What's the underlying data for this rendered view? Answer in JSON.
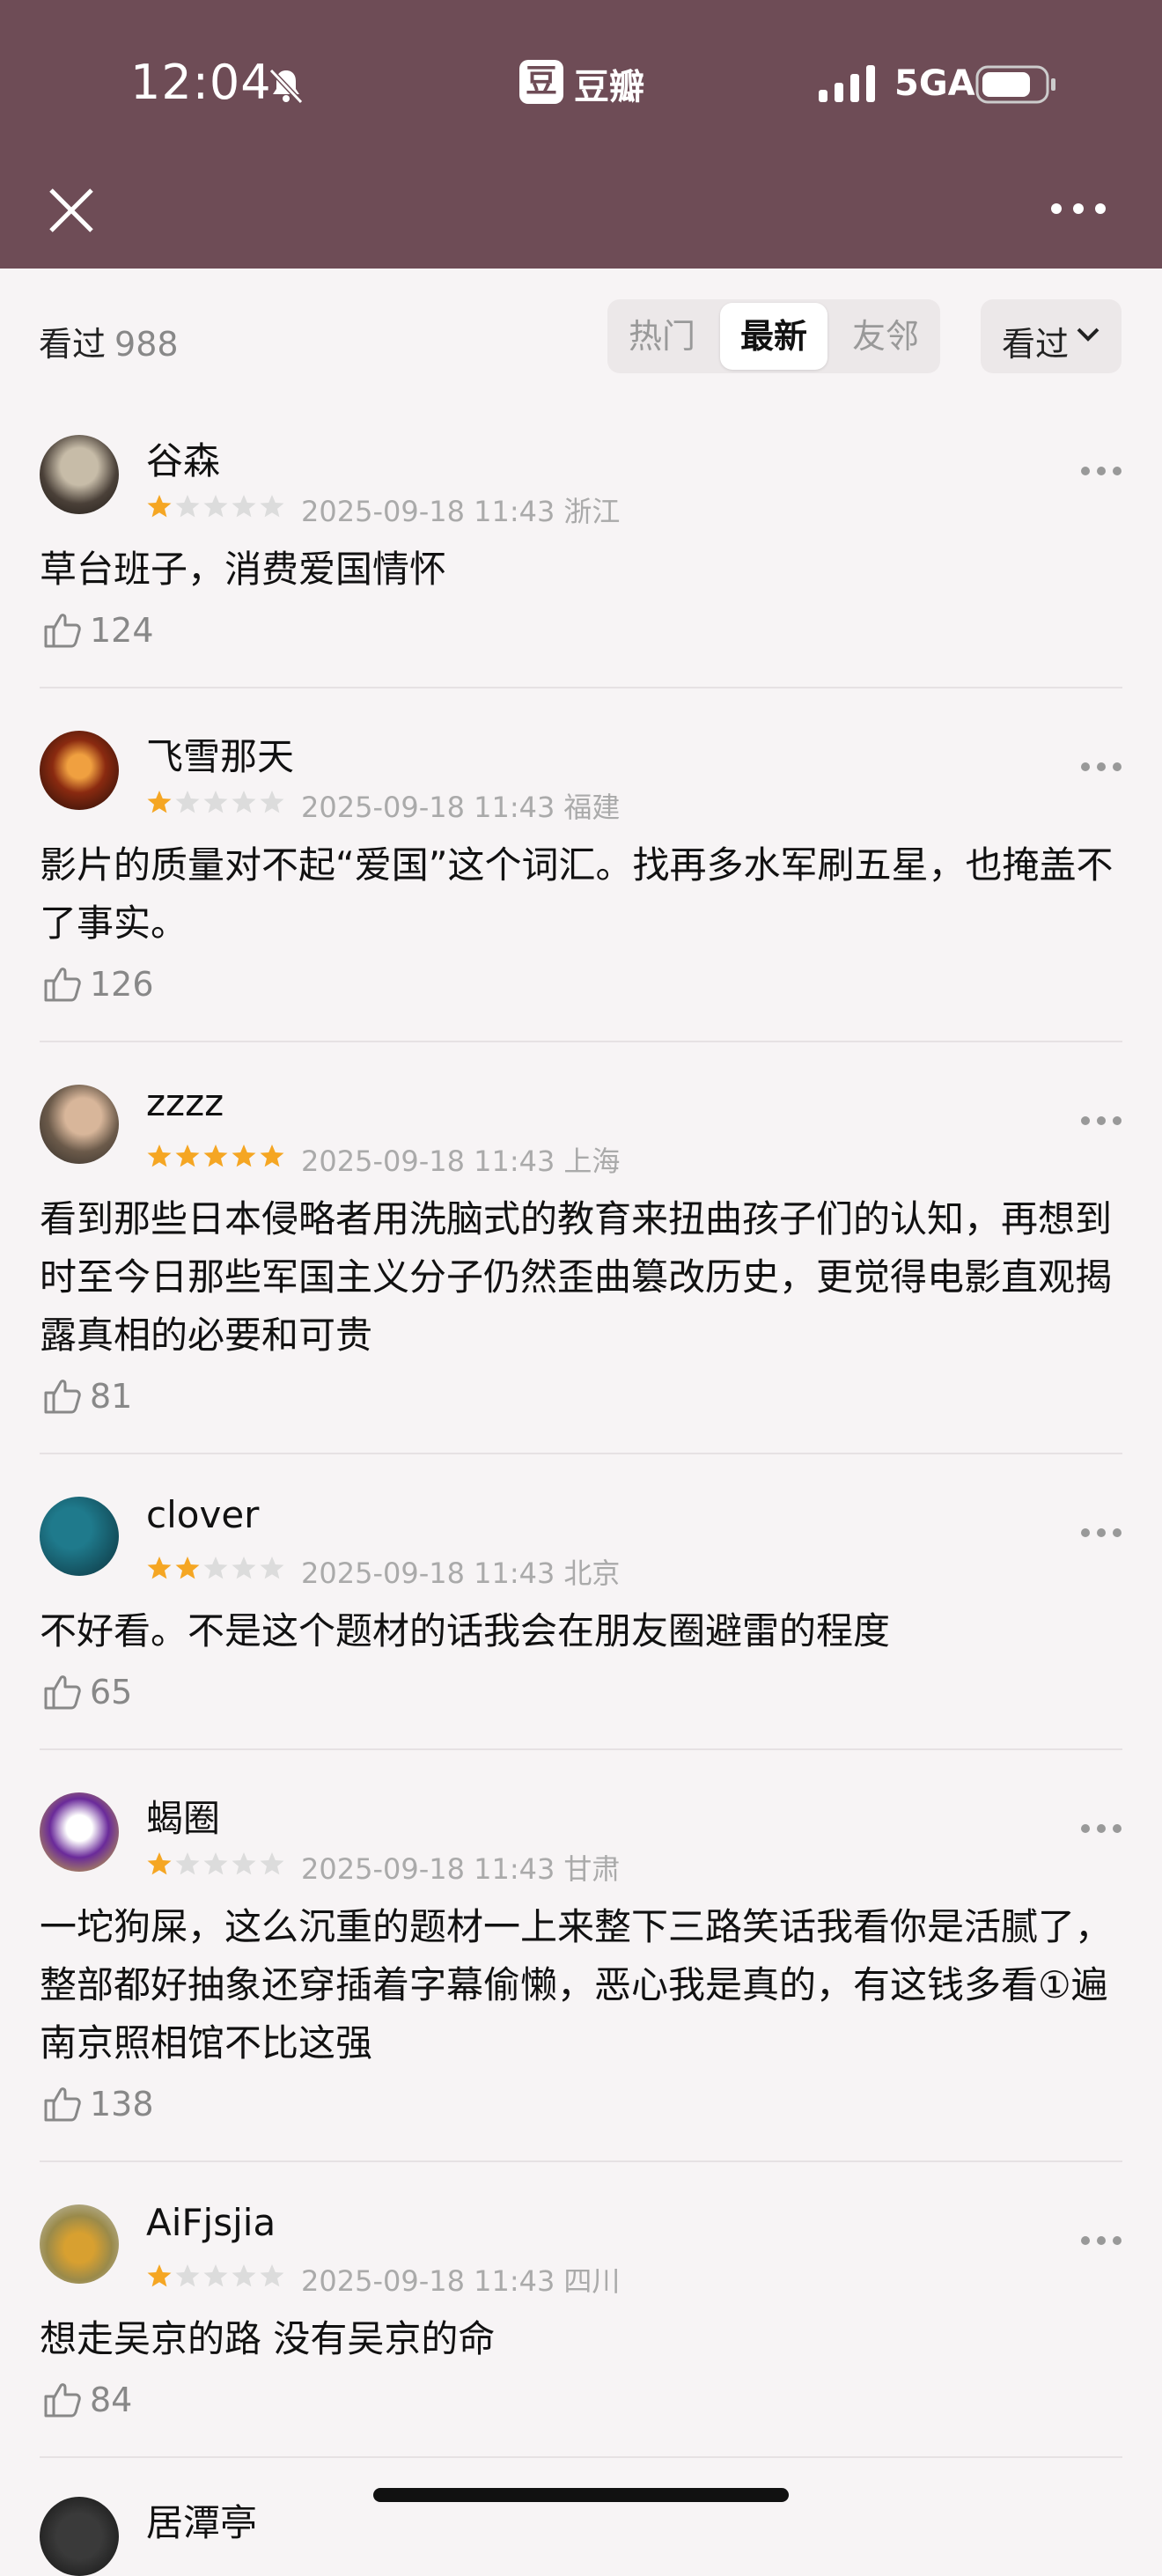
{
  "status_bar": {
    "time": "12:04",
    "app_name": "豆瓣",
    "app_badge": "豆",
    "network": "5GA"
  },
  "filter": {
    "title": "看过",
    "count": "988",
    "tabs": [
      "热门",
      "最新",
      "友邻"
    ],
    "active_tab": "最新",
    "sort_label": "看过"
  },
  "colors": {
    "header_bg": "#6e4c56",
    "star_active": "#f5a623",
    "star_inactive": "#dcdcdc"
  },
  "reviews": [
    {
      "user": "谷森",
      "rating": 1,
      "date": "2025-09-18 11:43",
      "location": "浙江",
      "text": "草台班子，消费爱国情怀",
      "likes": "124"
    },
    {
      "user": "飞雪那天",
      "rating": 1,
      "date": "2025-09-18 11:43",
      "location": "福建",
      "text": "影片的质量对不起“爱国”这个词汇。找再多水军刷五星，也掩盖不了事实。",
      "likes": "126"
    },
    {
      "user": "zzzz",
      "rating": 5,
      "date": "2025-09-18 11:43",
      "location": "上海",
      "text": "看到那些日本侵略者用洗脑式的教育来扭曲孩子们的认知，再想到时至今日那些军国主义分子仍然歪曲篡改历史，更觉得电影直观揭露真相的必要和可贵",
      "likes": "81"
    },
    {
      "user": "clover",
      "rating": 2,
      "date": "2025-09-18 11:43",
      "location": "北京",
      "text": "不好看。不是这个题材的话我会在朋友圈避雷的程度",
      "likes": "65"
    },
    {
      "user": "蝎圈",
      "rating": 1,
      "date": "2025-09-18 11:43",
      "location": "甘肃",
      "text": "一坨狗屎，这么沉重的题材一上来整下三路笑话我看你是活腻了，整部都好抽象还穿插着字幕偷懒，恶心我是真的，有这钱多看①遍南京照相馆不比这强",
      "likes": "138"
    },
    {
      "user": "AiFjsjia",
      "rating": 1,
      "date": "2025-09-18 11:43",
      "location": "四川",
      "text": "想走吴京的路 没有吴京的命",
      "likes": "84"
    },
    {
      "user": "居潭亭",
      "rating": 0,
      "date": "",
      "location": "",
      "text": "",
      "likes": ""
    }
  ]
}
